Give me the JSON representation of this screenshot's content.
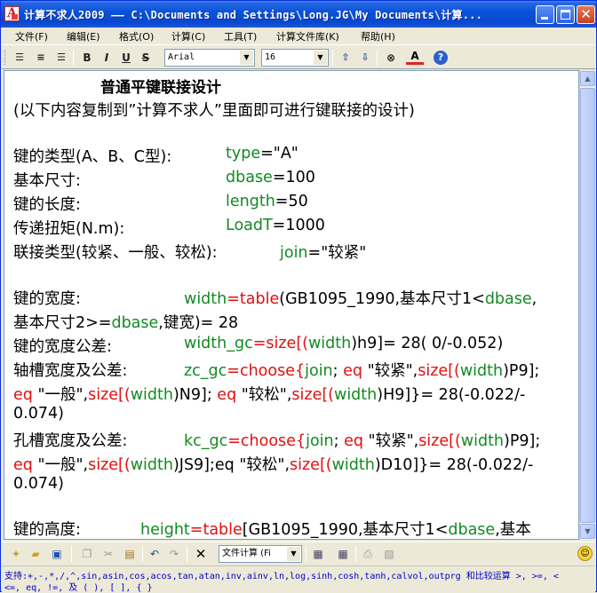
{
  "window": {
    "title": "计算不求人2009 —— C:\\Documents and Settings\\Long.JG\\My Documents\\计算...",
    "app_icon_glyph": "A"
  },
  "menu": [
    "文件(F)",
    "编辑(E)",
    "格式(O)",
    "计算(C)",
    "工具(T)",
    "计算文件库(K)",
    "帮助(H)"
  ],
  "toolbar": {
    "font_name": "Arial",
    "font_size": "16",
    "bold": "B",
    "italic": "I",
    "underline": "U",
    "strike": "S",
    "color_letter": "A",
    "help": "?"
  },
  "document": {
    "heading": "普通平键联接设计",
    "note": "(以下内容复制到”计算不求人”里面即可进行键联接的设计)",
    "rows": [
      {
        "label": "键的类型(A、B、C型):",
        "var": "type",
        "op": "=",
        "val": "\"A\""
      },
      {
        "label": "基本尺寸:",
        "var": "dbase",
        "op": "=",
        "val": "100"
      },
      {
        "label": "键的长度:",
        "var": "length",
        "op": "=",
        "val": "50"
      },
      {
        "label": "传递扭矩(N.m):",
        "var": "LoadT",
        "op": "=",
        "val": "1000"
      },
      {
        "label": "联接类型(较紧、一般、较松):",
        "var": "join",
        "op": "=",
        "val": "\"较紧\""
      }
    ],
    "width": {
      "label": "键的宽度:",
      "l1": [
        "width",
        "=",
        "table",
        "(GB1095_1990,基本尺寸1<",
        "dbase",
        ","
      ],
      "l2": [
        "基本尺寸2>=",
        "dbase",
        ",键宽)= 28"
      ]
    },
    "width_gc": {
      "label": "键的宽度公差:",
      "l1": [
        "width_gc",
        "=",
        "size",
        "[(",
        "width",
        ")h9]= 28( 0/-0.052)"
      ]
    },
    "zc_gc": {
      "label": "轴槽宽度及公差:",
      "l1": [
        "zc_gc",
        "=",
        "choose",
        "{",
        "join",
        "; ",
        "eq",
        " \"较紧\",",
        "size",
        "[(",
        "width",
        ")P9];"
      ],
      "l2": [
        "eq",
        " \"一般\",",
        "size",
        "[(",
        "width",
        ")N9]; ",
        "eq",
        " \"较松\",",
        "size",
        "[(",
        "width",
        ")H9]}= 28(-0.022/-"
      ],
      "l3": "0.074)"
    },
    "kc_gc": {
      "label": "孔槽宽度及公差:",
      "l1": [
        "kc_gc",
        "=",
        "choose",
        "{",
        "join",
        "; ",
        "eq",
        " \"较紧\",",
        "size",
        "[(",
        "width",
        ")P9];"
      ],
      "l2": [
        "eq",
        " \"一般\",",
        "size",
        "[(",
        "width",
        ")JS9];eq \"较松\",",
        "size",
        "[(",
        "width",
        ")D10]}= 28(-0.022/-"
      ],
      "l3": "0.074)"
    },
    "height": {
      "label": "键的高度:",
      "l1": [
        "height",
        "=",
        "table",
        "[GB1095_1990,基本尺寸1<",
        "dbase",
        ",基本"
      ]
    }
  },
  "bottom_toolbar": {
    "file_combo": "文件计算 (Fi"
  },
  "status": {
    "line1": "支持:+,-,*,/,^,sin,asin,cos,acos,tan,atan,inv,ainv,ln,log,sinh,cosh,tanh,calvol,outprg 和比较运算 >, >=, <",
    "line2": "<=, eq, !=, 及 ( ), [ ], { }"
  }
}
